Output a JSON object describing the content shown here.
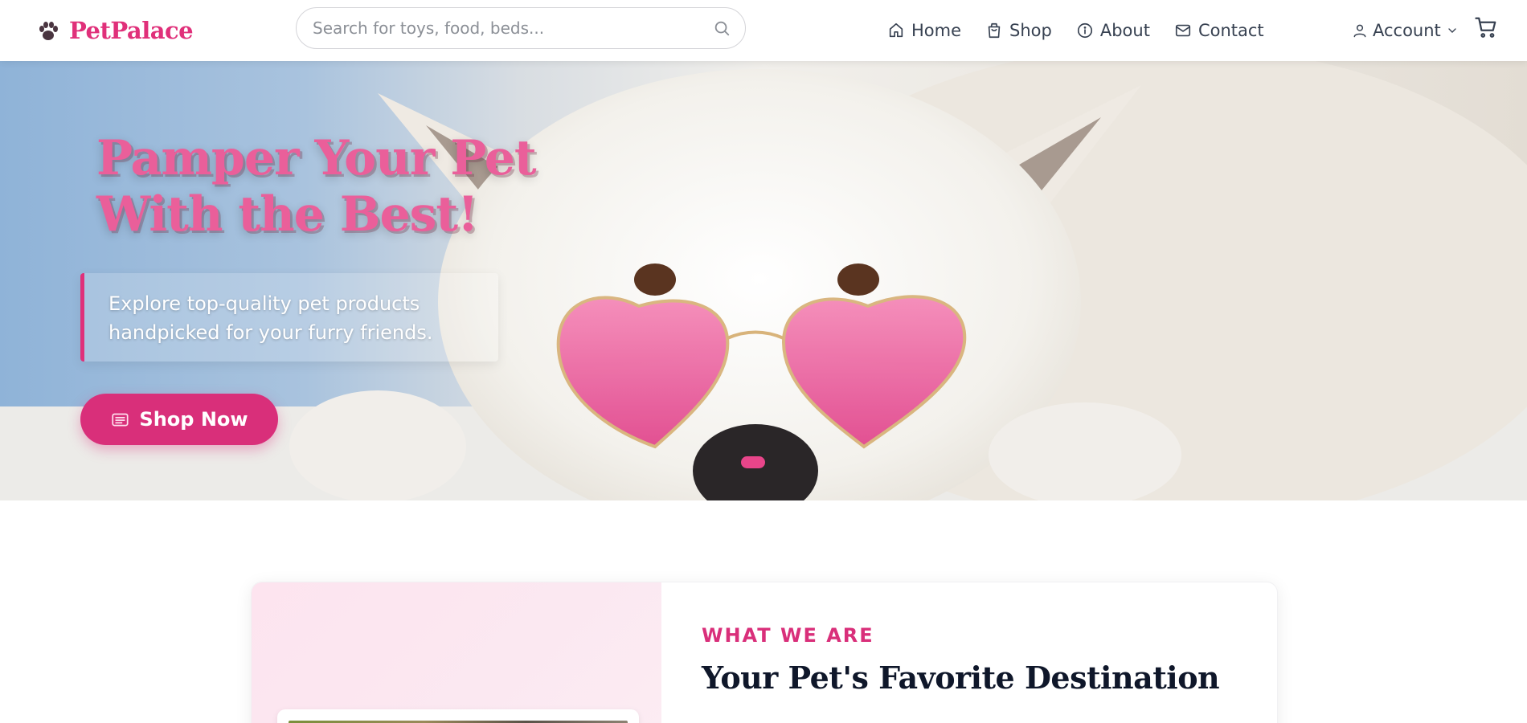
{
  "brand": {
    "name": "PetPalace",
    "color": "#e0307a"
  },
  "search": {
    "placeholder": "Search for toys, food, beds...",
    "value": ""
  },
  "nav": {
    "items": [
      {
        "label": "Home",
        "icon": "home-icon"
      },
      {
        "label": "Shop",
        "icon": "shopping-bag-icon"
      },
      {
        "label": "About",
        "icon": "info-icon"
      },
      {
        "label": "Contact",
        "icon": "mail-icon"
      }
    ]
  },
  "account": {
    "label": "Account",
    "icon": "user-icon"
  },
  "hero": {
    "title_line1": "Pamper Your Pet",
    "title_line2": "With the Best!",
    "subtitle_line1": "Explore top-quality pet products",
    "subtitle_line2": "handpicked for your furry friends.",
    "button_label": "Shop Now",
    "button_icon": "bag-icon",
    "image": "white-dog-wearing-pink-heart-sunglasses",
    "slide_indicator": {
      "active": 1,
      "count": 1
    }
  },
  "about": {
    "label": "WHAT WE ARE",
    "title": "Your Pet's Favorite Destination"
  },
  "colors": {
    "accent": "#d92f7a",
    "text": "#374151",
    "heading": "#0f172a"
  }
}
